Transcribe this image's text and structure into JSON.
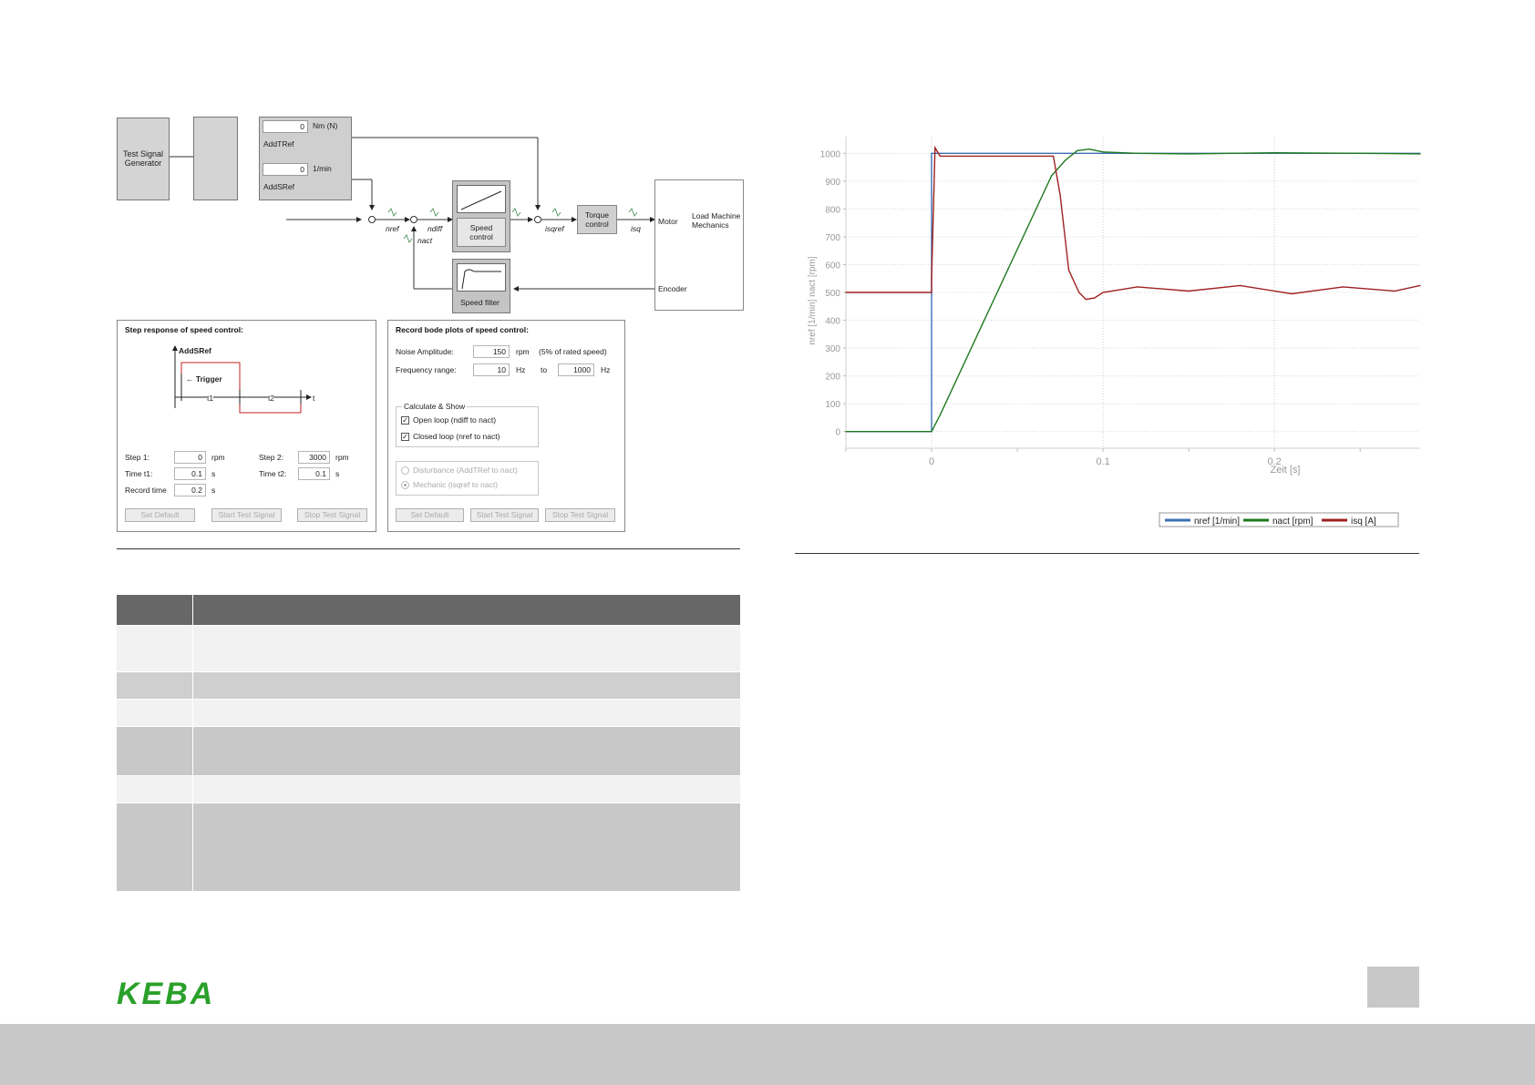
{
  "diagram": {
    "test_signal_generator": "Test Signal Generator",
    "add_t_ref": {
      "value": "0",
      "unit": "Nm (N)",
      "label": "AddTRef"
    },
    "add_s_ref": {
      "value": "0",
      "unit": "1/min",
      "label": "AddSRef"
    },
    "signals": {
      "nref": "nref",
      "ndiff": "ndiff",
      "nact": "nact",
      "isqref": "isqref",
      "isq": "isq"
    },
    "speed_control": "Speed control",
    "torque_control": "Torque control",
    "speed_filter": "Speed filter",
    "motor": "Motor",
    "load_machine": "Load Machine Mechanics",
    "encoder": "Encoder"
  },
  "step_panel": {
    "title": "Step response of speed control:",
    "graph_label": "AddSRef",
    "trigger": "Trigger",
    "t1": "t1",
    "t2": "t2",
    "t": "t",
    "step1_label": "Step 1:",
    "step1_value": "0",
    "step1_unit": "rpm",
    "step2_label": "Step 2:",
    "step2_value": "3000",
    "step2_unit": "rpm",
    "time1_label": "Time t1:",
    "time1_value": "0.1",
    "time1_unit": "s",
    "time2_label": "Time t2:",
    "time2_value": "0.1",
    "time2_unit": "s",
    "record_label": "Record time",
    "record_value": "0.2",
    "record_unit": "s",
    "buttons": [
      "Set Default",
      "Start Test Signal",
      "Stop Test Signal"
    ]
  },
  "bode_panel": {
    "title": "Record bode plots of speed control:",
    "noise_label": "Noise Amplitude:",
    "noise_value": "150",
    "noise_unit": "rpm",
    "noise_note": "(5% of rated speed)",
    "freq_label": "Frequency range:",
    "freq_from": "10",
    "freq_unit": "Hz",
    "freq_to_label": "to",
    "freq_to": "1000",
    "calc_group": "Calculate & Show",
    "open_loop": "Open loop (ndiff to nact)",
    "closed_loop": "Closed loop (nref to nact)",
    "disturbance": "Disturbance (AddTRef to nact)",
    "mechanic": "Mechanic (isqref to nact)",
    "buttons": [
      "Set Default",
      "Start Test Signal",
      "Stop Test Signal"
    ]
  },
  "colors": {
    "nref": "#3d6fb6",
    "nact": "#1e7a1e",
    "isq": "#a02020",
    "logo": "#2aa02a",
    "table_header": "#676767",
    "footer": "#c8c8c8"
  },
  "logo": "KEBA",
  "chart_data": {
    "type": "line",
    "xlabel": "Zeit [s]",
    "ylabel": "nref [1/min]  nact [rpm]",
    "xlim": [
      -0.05,
      0.285
    ],
    "ylim": [
      -60,
      1060
    ],
    "x_ticks": [
      "0",
      "0.1",
      "0.2"
    ],
    "y_ticks": [
      "0",
      "100",
      "200",
      "300",
      "400",
      "500",
      "600",
      "700",
      "800",
      "900",
      "1000"
    ],
    "grid": true,
    "legend_position": "bottom-right",
    "series": [
      {
        "name": "nref [1/min]",
        "x": [
          -0.05,
          0.0,
          0.0,
          0.285
        ],
        "y": [
          0,
          0,
          1000,
          1000
        ]
      },
      {
        "name": "nact [rpm]",
        "x": [
          -0.05,
          0.0,
          0.005,
          0.07,
          0.078,
          0.085,
          0.092,
          0.1,
          0.12,
          0.15,
          0.2,
          0.25,
          0.285
        ],
        "y": [
          0,
          0,
          60,
          920,
          975,
          1010,
          1015,
          1005,
          1000,
          998,
          1002,
          1000,
          998
        ]
      },
      {
        "name": "isq [A]",
        "x": [
          -0.05,
          0.0,
          0.0,
          0.002,
          0.005,
          0.071,
          0.075,
          0.08,
          0.086,
          0.09,
          0.095,
          0.1,
          0.12,
          0.15,
          0.18,
          0.21,
          0.24,
          0.27,
          0.285
        ],
        "y": [
          500,
          500,
          550,
          1020,
          990,
          990,
          850,
          580,
          500,
          475,
          480,
          500,
          520,
          505,
          525,
          495,
          520,
          505,
          525
        ]
      }
    ]
  }
}
